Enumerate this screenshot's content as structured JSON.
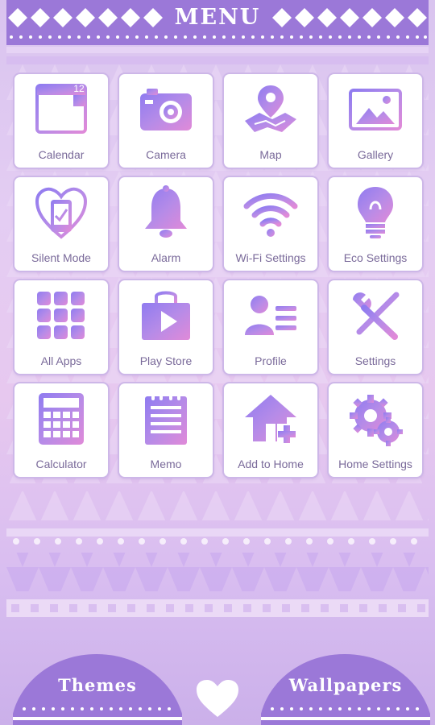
{
  "header": {
    "title": "MENU"
  },
  "colors": {
    "accent": "#9b78d8",
    "tile_bg": "#ffffff",
    "icon_gradient_a": "#8f7bf0",
    "icon_gradient_b": "#e08ad8"
  },
  "tiles": [
    {
      "label": "Calendar",
      "icon": "calendar-icon",
      "badge": "12"
    },
    {
      "label": "Camera",
      "icon": "camera-icon"
    },
    {
      "label": "Map",
      "icon": "map-icon"
    },
    {
      "label": "Gallery",
      "icon": "gallery-icon"
    },
    {
      "label": "Silent Mode",
      "icon": "silent-mode-icon"
    },
    {
      "label": "Alarm",
      "icon": "alarm-bell-icon"
    },
    {
      "label": "Wi-Fi Settings",
      "icon": "wifi-icon"
    },
    {
      "label": "Eco Settings",
      "icon": "bulb-icon"
    },
    {
      "label": "All Apps",
      "icon": "app-grid-icon"
    },
    {
      "label": "Play Store",
      "icon": "play-store-icon"
    },
    {
      "label": "Profile",
      "icon": "profile-icon"
    },
    {
      "label": "Settings",
      "icon": "tools-icon"
    },
    {
      "label": "Calculator",
      "icon": "calculator-icon"
    },
    {
      "label": "Memo",
      "icon": "memo-icon"
    },
    {
      "label": "Add to Home",
      "icon": "add-home-icon"
    },
    {
      "label": "Home Settings",
      "icon": "gears-icon"
    }
  ],
  "footer": {
    "themes_label": "Themes",
    "wallpapers_label": "Wallpapers",
    "center_icon": "heart-icon"
  }
}
